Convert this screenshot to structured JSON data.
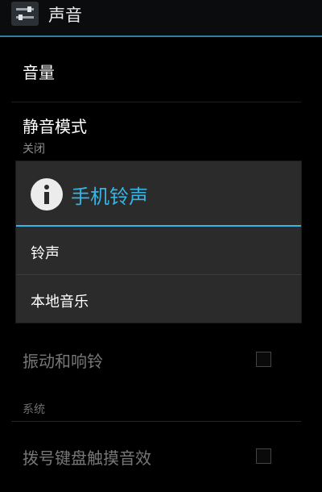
{
  "actionbar": {
    "title": "声音",
    "icon": "sound-settings-icon"
  },
  "prefs": {
    "volume": "音量",
    "silent_mode": {
      "title": "静音模式",
      "summary": "关闭"
    },
    "vibrate_and_ring": "振动和响铃",
    "section_system": "系统",
    "dialpad_touch_tones": "拨号键盘触摸音效"
  },
  "dialog": {
    "title": "手机铃声",
    "icon": "info-icon",
    "items": [
      "铃声",
      "本地音乐"
    ]
  },
  "colors": {
    "accent": "#33b5e5",
    "background": "#000000",
    "dialog": "#2b2b2c"
  }
}
